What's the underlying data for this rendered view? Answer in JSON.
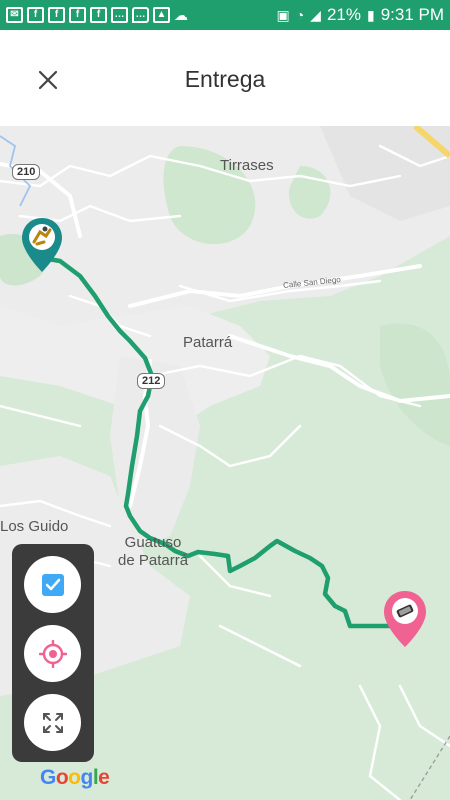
{
  "status_bar": {
    "notification_icons": [
      "message-icon",
      "facebook-icon",
      "facebook-icon",
      "facebook-icon",
      "facebook-icon",
      "chat-icon",
      "chat-icon",
      "image-icon",
      "cloud-icon"
    ],
    "battery_percent": "21%",
    "time": "9:31 PM"
  },
  "header": {
    "title": "Entrega",
    "close_icon": "close-icon"
  },
  "map": {
    "place_labels": {
      "tirrases": "Tirrases",
      "patarra": "Patarrá",
      "los_guido": "Los Guido",
      "guatuso": "Guatuso\nde Patarrá"
    },
    "road_shields": {
      "r210": "210",
      "r212": "212"
    },
    "street": {
      "calle_san_diego": "Calle San Diego"
    },
    "route_color": "#1f9e6e",
    "origin_pin": {
      "icon": "courier-icon",
      "color": "#1b8a8a"
    },
    "destination_pin": {
      "icon": "phone-icon",
      "color": "#f06292"
    },
    "attribution": "Google"
  },
  "controls": {
    "checkbox_icon": "checkbox-icon",
    "locate_icon": "locate-icon",
    "fullscreen_icon": "fullscreen-icon"
  }
}
